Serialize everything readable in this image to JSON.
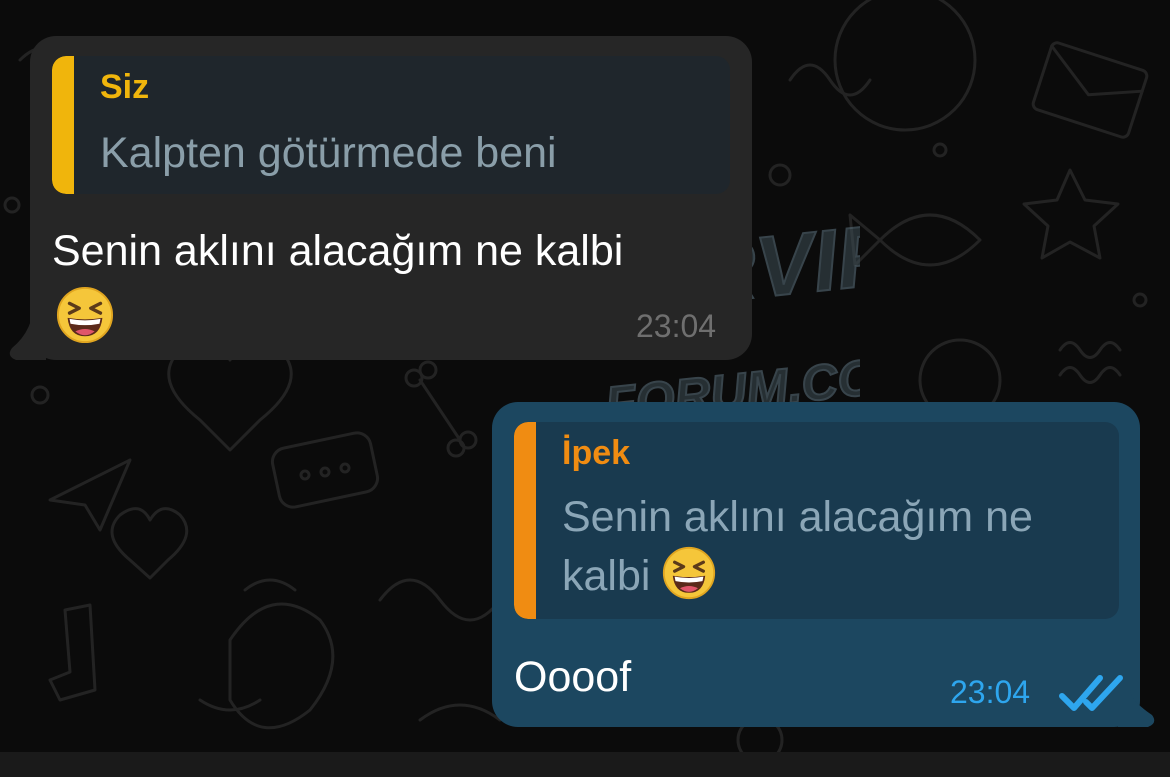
{
  "incoming_message": {
    "reply_author": "Siz",
    "reply_text": "Kalpten götürmede beni",
    "text": "Senin aklını alacağım ne kalbi",
    "emoji": "grinning-squinting-face",
    "time": "23:04"
  },
  "outgoing_message": {
    "reply_author": "İpek",
    "reply_text": "Senin aklını alacağım ne kalbi",
    "reply_emoji": "grinning-squinting-face",
    "text": "Oooof",
    "time": "23:04",
    "status": "read"
  },
  "watermark": {
    "line1": "ESCOBARVIP",
    "line2": "FORUM.CO"
  },
  "colors": {
    "incoming_bubble": "#262626",
    "outgoing_bubble": "#1c4760",
    "incoming_quote_accent": "#f0b50c",
    "outgoing_quote_accent": "#f08c12",
    "read_check": "#2ea6ee"
  }
}
